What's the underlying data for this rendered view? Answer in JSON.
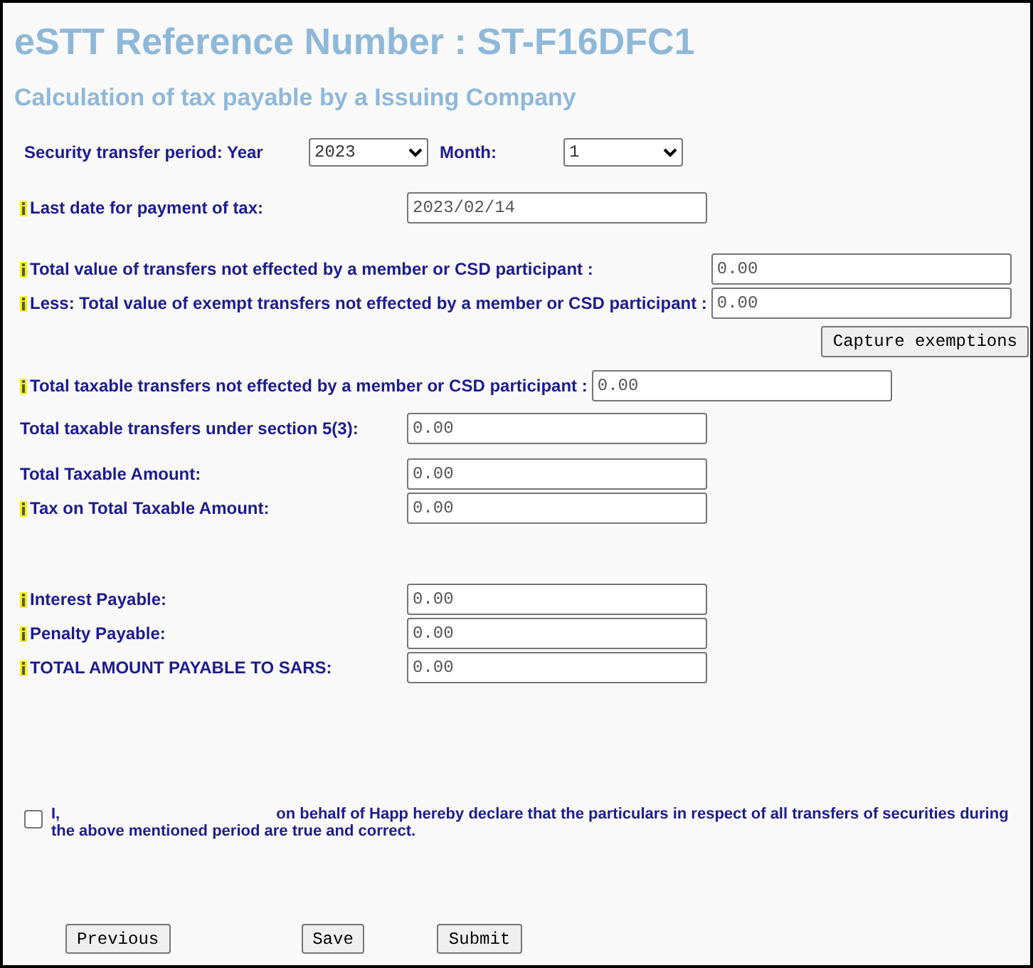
{
  "title": "eSTT Reference Number : ST-F16DFC1",
  "subtitle": "Calculation of tax payable by a Issuing Company",
  "period": {
    "year_label": "Security transfer period: Year",
    "year": "2023",
    "month_label": "Month:",
    "month": "1"
  },
  "sections": [
    {
      "rows": [
        {
          "label": "Last date for payment of tax:",
          "info": true,
          "value": "2023/02/14"
        }
      ]
    },
    {
      "rows": [
        {
          "label": "Total value of transfers not effected by a member or CSD participant :",
          "info": true,
          "value": "0.00"
        },
        {
          "label": "Less: Total value of exempt transfers not effected by a member or CSD participant :",
          "info": true,
          "value": "0.00"
        }
      ],
      "button": "Capture exemptions"
    },
    {
      "rows": [
        {
          "label": "Total taxable transfers not effected by a member or CSD participant :",
          "info": true,
          "value": "0.00"
        }
      ]
    },
    {
      "rows": [
        {
          "label": "Total taxable transfers under section 5(3):",
          "info": false,
          "value": "0.00"
        }
      ]
    },
    {
      "rows": [
        {
          "label": "Total Taxable Amount:",
          "info": false,
          "value": "0.00"
        },
        {
          "label": "Tax on Total Taxable Amount:",
          "info": true,
          "value": "0.00"
        }
      ]
    },
    {
      "rows": [
        {
          "label": "Interest Payable:",
          "info": true,
          "value": "0.00"
        },
        {
          "label": "Penalty Payable:",
          "info": true,
          "value": "0.00"
        },
        {
          "label": "TOTAL AMOUNT PAYABLE TO SARS:",
          "info": true,
          "value": "0.00"
        }
      ]
    }
  ],
  "declaration": {
    "checked": false,
    "prefix": "I,",
    "text": "on behalf of Happ hereby declare that the particulars in respect of all transfers of securities during the above mentioned period are true and correct."
  },
  "buttons": [
    "Previous",
    "Save",
    "Submit"
  ]
}
